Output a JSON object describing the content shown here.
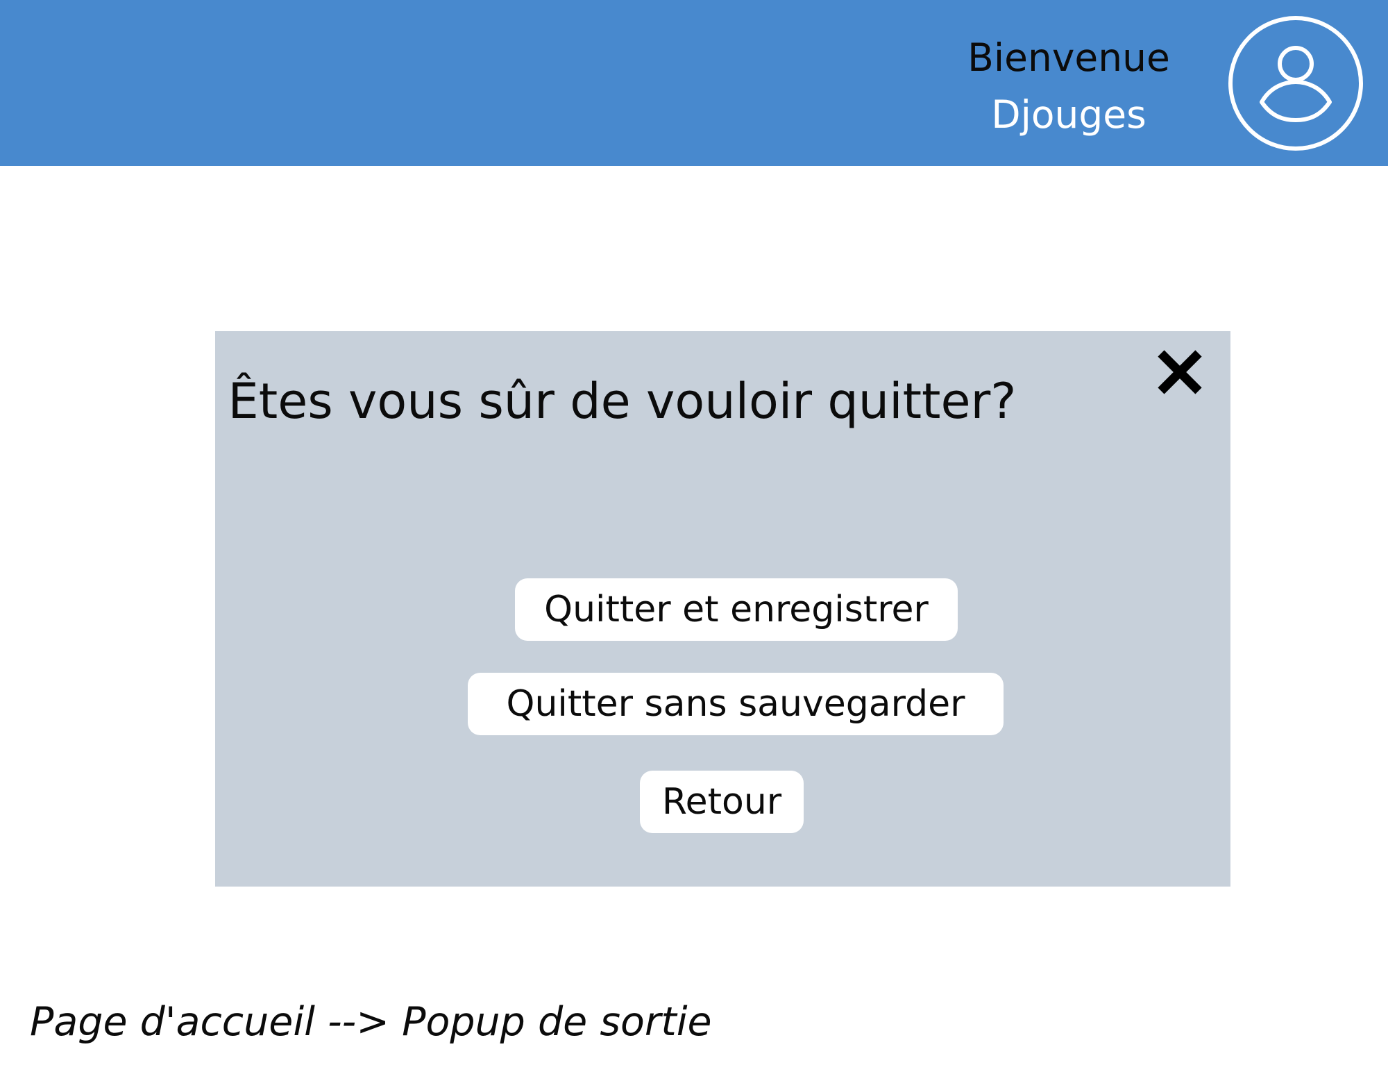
{
  "header": {
    "greeting": "Bienvenue",
    "username": "Djouges",
    "avatar_icon": "user-circle-icon",
    "background_color": "#4889ce"
  },
  "modal": {
    "title": "Êtes vous sûr de vouloir quitter?",
    "close_icon": "close-icon",
    "background_color": "#c7d0da",
    "buttons": {
      "save_and_quit": "Quitter et enregistrer",
      "quit_without_saving": "Quitter sans sauvegarder",
      "back": "Retour"
    }
  },
  "caption": "Page d'accueil --> Popup de sortie"
}
